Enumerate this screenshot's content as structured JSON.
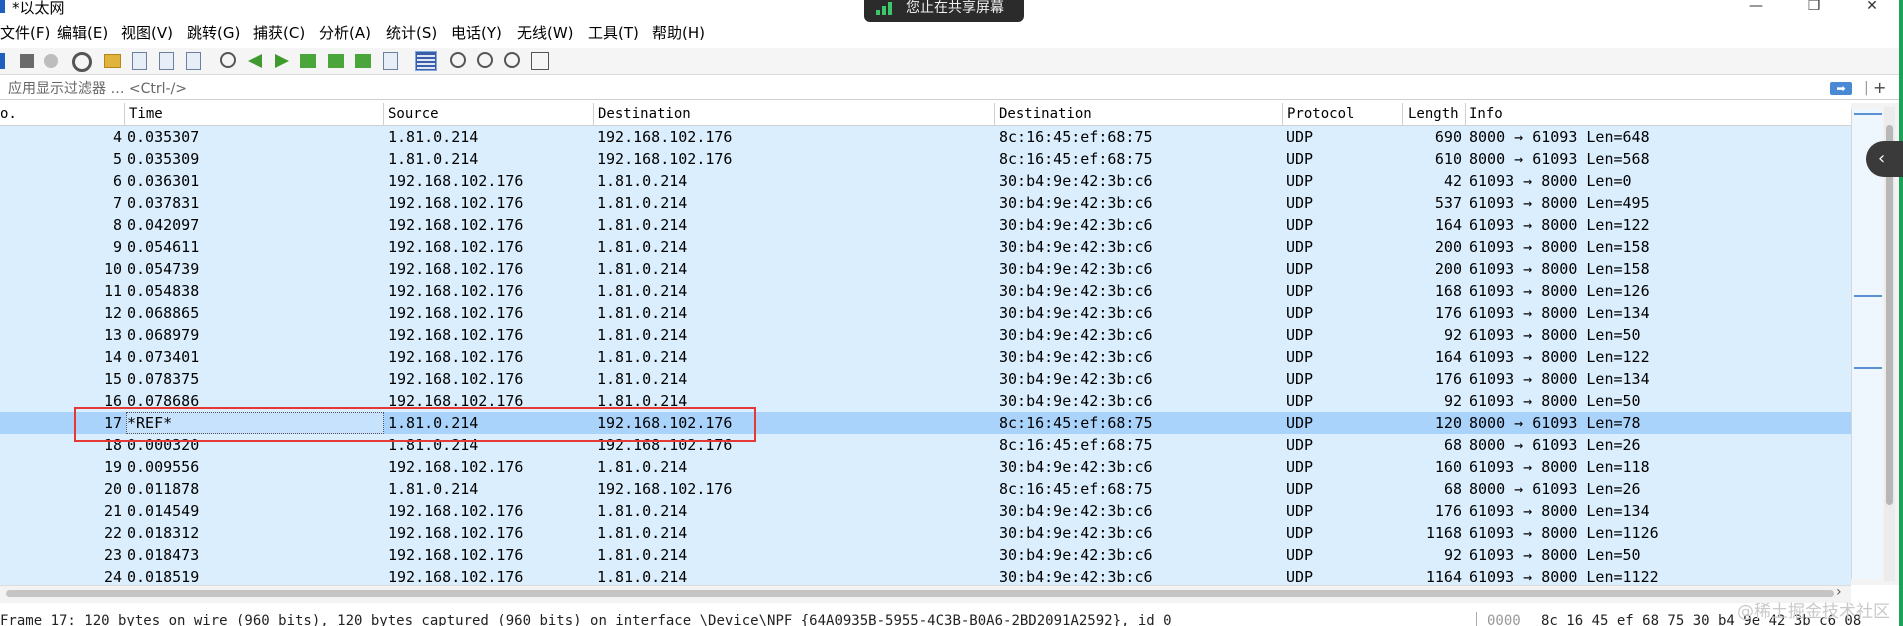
{
  "window": {
    "title": "*以太网",
    "share_banner": "您止在共享屏幕",
    "controls": {
      "minimize": "—",
      "maximize": "❐",
      "close": "✕"
    }
  },
  "menu": [
    "文件(F)",
    "编辑(E)",
    "视图(V)",
    "跳转(G)",
    "捕获(C)",
    "分析(A)",
    "统计(S)",
    "电话(Y)",
    "无线(W)",
    "工具(T)",
    "帮助(H)"
  ],
  "filter": {
    "placeholder": "应用显示过滤器 … <Ctrl-/>",
    "apply_glyph": "➡",
    "add_glyph": "+"
  },
  "columns": [
    "o.",
    "Time",
    "Source",
    "Destination",
    "Destination",
    "Protocol",
    "Length",
    "Info"
  ],
  "packets": [
    {
      "no": "4",
      "time": "0.035307",
      "src": "1.81.0.214",
      "dst": "192.168.102.176",
      "mac": "8c:16:45:ef:68:75",
      "proto": "UDP",
      "len": "690",
      "info": "8000 → 61093 Len=648"
    },
    {
      "no": "5",
      "time": "0.035309",
      "src": "1.81.0.214",
      "dst": "192.168.102.176",
      "mac": "8c:16:45:ef:68:75",
      "proto": "UDP",
      "len": "610",
      "info": "8000 → 61093 Len=568"
    },
    {
      "no": "6",
      "time": "0.036301",
      "src": "192.168.102.176",
      "dst": "1.81.0.214",
      "mac": "30:b4:9e:42:3b:c6",
      "proto": "UDP",
      "len": "42",
      "info": "61093 → 8000 Len=0"
    },
    {
      "no": "7",
      "time": "0.037831",
      "src": "192.168.102.176",
      "dst": "1.81.0.214",
      "mac": "30:b4:9e:42:3b:c6",
      "proto": "UDP",
      "len": "537",
      "info": "61093 → 8000 Len=495"
    },
    {
      "no": "8",
      "time": "0.042097",
      "src": "192.168.102.176",
      "dst": "1.81.0.214",
      "mac": "30:b4:9e:42:3b:c6",
      "proto": "UDP",
      "len": "164",
      "info": "61093 → 8000 Len=122"
    },
    {
      "no": "9",
      "time": "0.054611",
      "src": "192.168.102.176",
      "dst": "1.81.0.214",
      "mac": "30:b4:9e:42:3b:c6",
      "proto": "UDP",
      "len": "200",
      "info": "61093 → 8000 Len=158"
    },
    {
      "no": "10",
      "time": "0.054739",
      "src": "192.168.102.176",
      "dst": "1.81.0.214",
      "mac": "30:b4:9e:42:3b:c6",
      "proto": "UDP",
      "len": "200",
      "info": "61093 → 8000 Len=158"
    },
    {
      "no": "11",
      "time": "0.054838",
      "src": "192.168.102.176",
      "dst": "1.81.0.214",
      "mac": "30:b4:9e:42:3b:c6",
      "proto": "UDP",
      "len": "168",
      "info": "61093 → 8000 Len=126"
    },
    {
      "no": "12",
      "time": "0.068865",
      "src": "192.168.102.176",
      "dst": "1.81.0.214",
      "mac": "30:b4:9e:42:3b:c6",
      "proto": "UDP",
      "len": "176",
      "info": "61093 → 8000 Len=134"
    },
    {
      "no": "13",
      "time": "0.068979",
      "src": "192.168.102.176",
      "dst": "1.81.0.214",
      "mac": "30:b4:9e:42:3b:c6",
      "proto": "UDP",
      "len": "92",
      "info": "61093 → 8000 Len=50"
    },
    {
      "no": "14",
      "time": "0.073401",
      "src": "192.168.102.176",
      "dst": "1.81.0.214",
      "mac": "30:b4:9e:42:3b:c6",
      "proto": "UDP",
      "len": "164",
      "info": "61093 → 8000 Len=122"
    },
    {
      "no": "15",
      "time": "0.078375",
      "src": "192.168.102.176",
      "dst": "1.81.0.214",
      "mac": "30:b4:9e:42:3b:c6",
      "proto": "UDP",
      "len": "176",
      "info": "61093 → 8000 Len=134"
    },
    {
      "no": "16",
      "time": "0.078686",
      "src": "192.168.102.176",
      "dst": "1.81.0.214",
      "mac": "30:b4:9e:42:3b:c6",
      "proto": "UDP",
      "len": "92",
      "info": "61093 → 8000 Len=50"
    },
    {
      "no": "17",
      "time": "*REF*",
      "src": "1.81.0.214",
      "dst": "192.168.102.176",
      "mac": "8c:16:45:ef:68:75",
      "proto": "UDP",
      "len": "120",
      "info": "8000 → 61093 Len=78",
      "selected": true
    },
    {
      "no": "18",
      "time": "0.000320",
      "src": "1.81.0.214",
      "dst": "192.168.102.176",
      "mac": "8c:16:45:ef:68:75",
      "proto": "UDP",
      "len": "68",
      "info": "8000 → 61093 Len=26"
    },
    {
      "no": "19",
      "time": "0.009556",
      "src": "192.168.102.176",
      "dst": "1.81.0.214",
      "mac": "30:b4:9e:42:3b:c6",
      "proto": "UDP",
      "len": "160",
      "info": "61093 → 8000 Len=118"
    },
    {
      "no": "20",
      "time": "0.011878",
      "src": "1.81.0.214",
      "dst": "192.168.102.176",
      "mac": "8c:16:45:ef:68:75",
      "proto": "UDP",
      "len": "68",
      "info": "8000 → 61093 Len=26"
    },
    {
      "no": "21",
      "time": "0.014549",
      "src": "192.168.102.176",
      "dst": "1.81.0.214",
      "mac": "30:b4:9e:42:3b:c6",
      "proto": "UDP",
      "len": "176",
      "info": "61093 → 8000 Len=134"
    },
    {
      "no": "22",
      "time": "0.018312",
      "src": "192.168.102.176",
      "dst": "1.81.0.214",
      "mac": "30:b4:9e:42:3b:c6",
      "proto": "UDP",
      "len": "1168",
      "info": "61093 → 8000 Len=1126"
    },
    {
      "no": "23",
      "time": "0.018473",
      "src": "192.168.102.176",
      "dst": "1.81.0.214",
      "mac": "30:b4:9e:42:3b:c6",
      "proto": "UDP",
      "len": "92",
      "info": "61093 → 8000 Len=50"
    },
    {
      "no": "24",
      "time": "0.018519",
      "src": "192.168.102.176",
      "dst": "1.81.0.214",
      "mac": "30:b4:9e:42:3b:c6",
      "proto": "UDP",
      "len": "1164",
      "info": "61093 → 8000 Len=1122"
    }
  ],
  "status": {
    "detail": "Frame 17: 120 bytes on wire (960 bits), 120 bytes captured (960 bits) on interface \\Device\\NPF_{64A0935B-5955-4C3B-B0A6-2BD2091A2592}, id 0",
    "hex_offset": "0000",
    "hex_bytes": "8c 16 45 ef 68 75 30 b4  9e 42 3b c6 08"
  },
  "scroll": {
    "side_handle_glyph": "‹",
    "h_chevron": "›"
  },
  "watermark": "@稀土掘金技术社区",
  "colors": {
    "row_bg": "#daeefe",
    "row_selected_bg": "#a9d3fb",
    "annotation_box": "#e53935",
    "window_edge": "#1ea25a"
  }
}
